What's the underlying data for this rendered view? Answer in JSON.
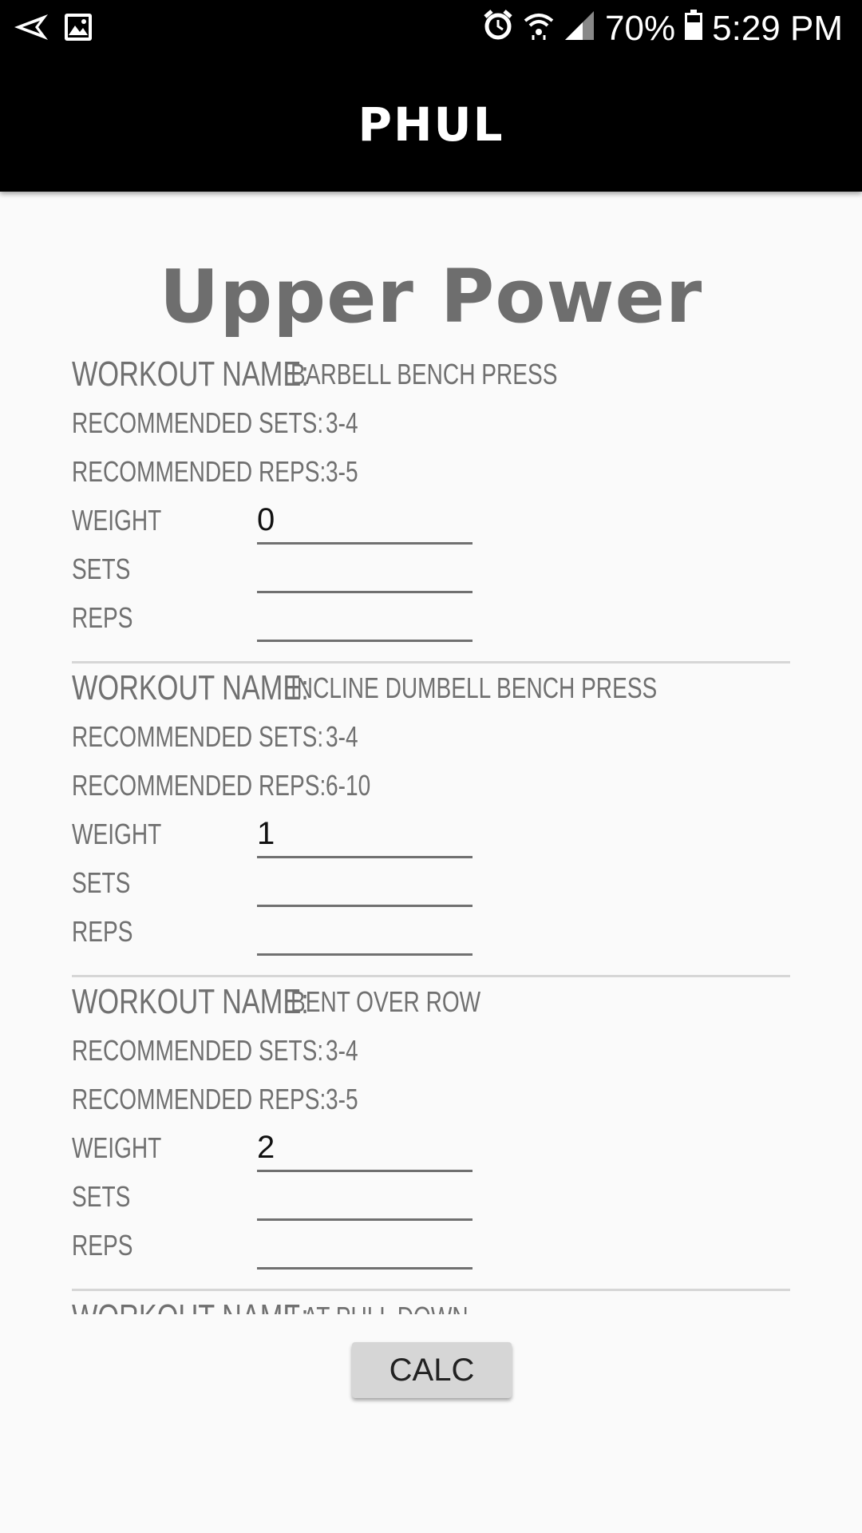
{
  "status_bar": {
    "battery": "70%",
    "time": "5:29 PM",
    "icons": [
      "send-icon",
      "image-icon",
      "alarm-icon",
      "wifi-icon",
      "signal-icon",
      "battery-icon"
    ]
  },
  "app_bar": {
    "title": "PHUL"
  },
  "page_title": "Upper Power",
  "labels": {
    "workout_name": "WORKOUT NAME:",
    "rec_sets": "RECOMMENDED SETS:",
    "rec_reps": "RECOMMENDED REPS:",
    "weight": "WEIGHT",
    "sets": "SETS",
    "reps": "REPS"
  },
  "workouts": [
    {
      "name": "BARBELL BENCH PRESS",
      "rec_sets": "3-4",
      "rec_reps": "3-5",
      "weight": "0",
      "sets": "",
      "reps": ""
    },
    {
      "name": "INCLINE DUMBELL BENCH PRESS",
      "rec_sets": "3-4",
      "rec_reps": "6-10",
      "weight": "1",
      "sets": "",
      "reps": ""
    },
    {
      "name": "BENT OVER ROW",
      "rec_sets": "3-4",
      "rec_reps": "3-5",
      "weight": "2",
      "sets": "",
      "reps": ""
    },
    {
      "name": "LAT PULL DOWN",
      "rec_sets": "",
      "rec_reps": "",
      "weight": "",
      "sets": "",
      "reps": ""
    }
  ],
  "calc_button": "CALC"
}
